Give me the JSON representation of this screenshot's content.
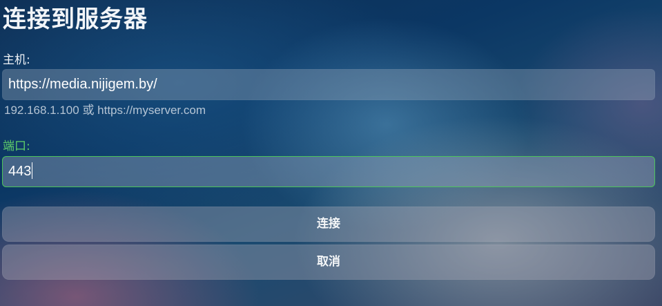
{
  "dialog": {
    "title": "连接到服务器"
  },
  "host": {
    "label": "主机:",
    "value": "https://media.nijigem.by/",
    "hint": "192.168.1.100 或 https://myserver.com"
  },
  "port": {
    "label": "端口:",
    "value": "443"
  },
  "buttons": {
    "connect": "连接",
    "cancel": "取消"
  },
  "colors": {
    "focus_accent": "#4cc45a",
    "focus_label": "#5fd06a"
  }
}
